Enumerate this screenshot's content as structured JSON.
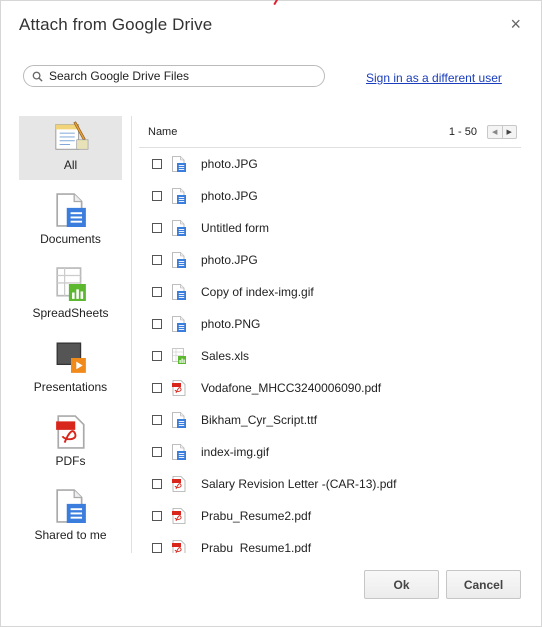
{
  "dialog": {
    "title": "Attach from Google Drive",
    "close_glyph": "×",
    "signin_link": "Sign in as a different user"
  },
  "search": {
    "placeholder": "Search Google Drive Files"
  },
  "sidebar": {
    "items": [
      {
        "label": "All",
        "icon": "all-files-icon",
        "active": true
      },
      {
        "label": "Documents",
        "icon": "document-icon"
      },
      {
        "label": "SpreadSheets",
        "icon": "spreadsheet-icon"
      },
      {
        "label": "Presentations",
        "icon": "presentation-icon"
      },
      {
        "label": "PDFs",
        "icon": "pdf-icon"
      },
      {
        "label": "Shared to me",
        "icon": "shared-document-icon"
      }
    ]
  },
  "filelist": {
    "column_name": "Name",
    "range": "1 - 50",
    "pager_prev": "◀",
    "pager_next": "▶",
    "files": [
      {
        "name": "photo.JPG",
        "type": "doc"
      },
      {
        "name": "photo.JPG",
        "type": "doc"
      },
      {
        "name": "Untitled form",
        "type": "doc"
      },
      {
        "name": "photo.JPG",
        "type": "doc"
      },
      {
        "name": "Copy of index-img.gif",
        "type": "doc"
      },
      {
        "name": "photo.PNG",
        "type": "doc"
      },
      {
        "name": "Sales.xls",
        "type": "sheet"
      },
      {
        "name": "Vodafone_MHCC3240006090.pdf",
        "type": "pdf"
      },
      {
        "name": "Bikham_Cyr_Script.ttf",
        "type": "doc"
      },
      {
        "name": "index-img.gif",
        "type": "doc"
      },
      {
        "name": "Salary Revision Letter -(CAR-13).pdf",
        "type": "pdf"
      },
      {
        "name": "Prabu_Resume2.pdf",
        "type": "pdf"
      },
      {
        "name": "Prabu_Resume1.pdf",
        "type": "pdf"
      }
    ]
  },
  "buttons": {
    "ok": "Ok",
    "cancel": "Cancel"
  },
  "colors": {
    "link": "#1a3dbd",
    "doc_blue": "#3b7ddd",
    "sheet_green": "#5cb82e",
    "pdf_red": "#d9261c",
    "slides_orange": "#f08a1b"
  }
}
